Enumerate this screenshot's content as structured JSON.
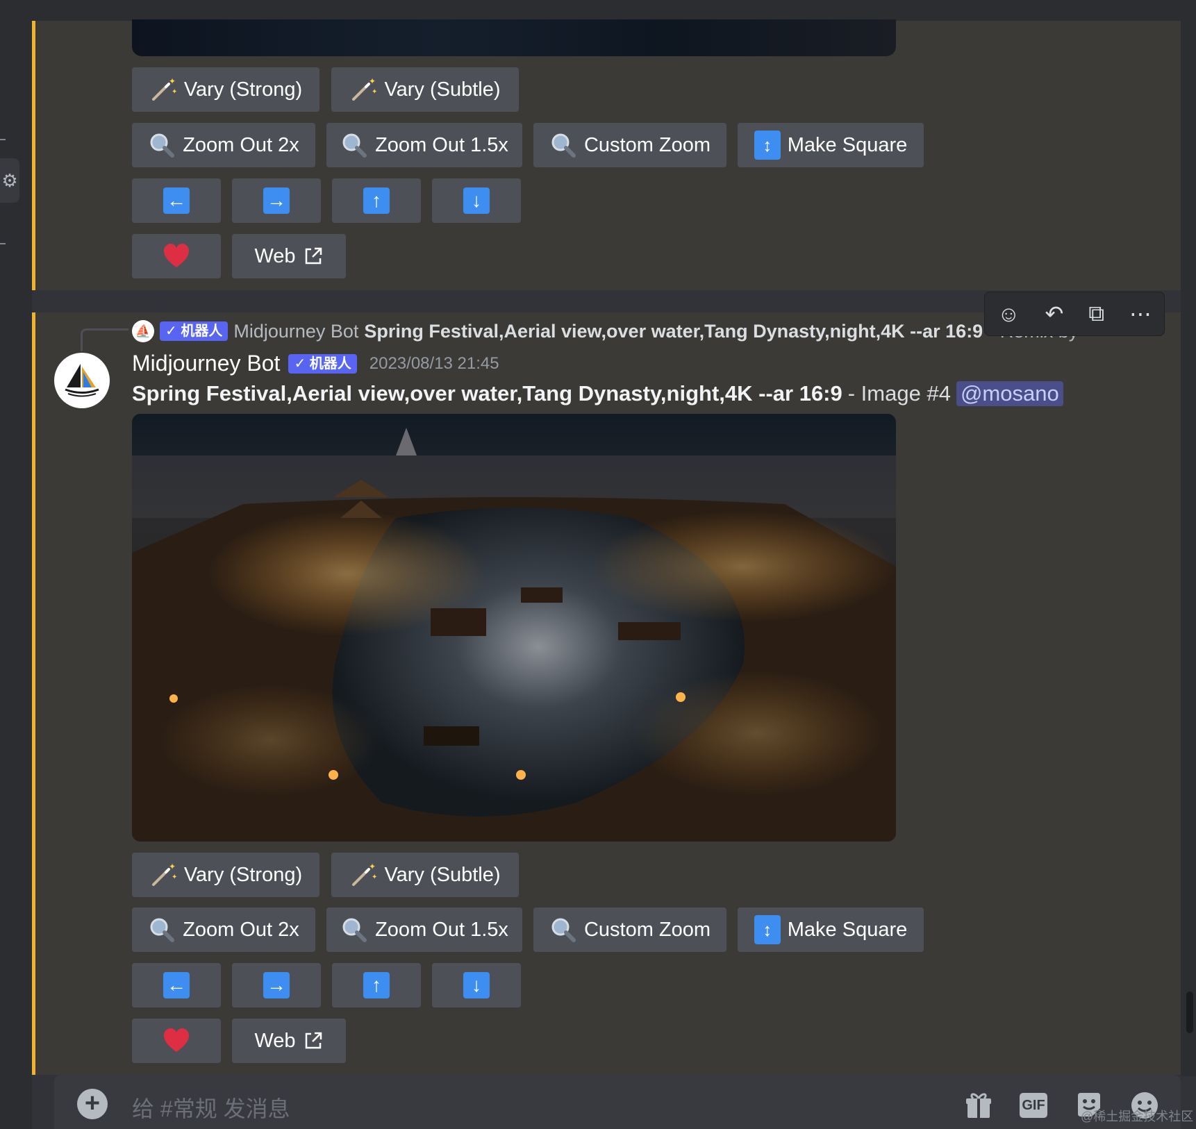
{
  "message_top": {
    "buttons_row1": [
      {
        "label": "Vary (Strong)",
        "icon": "magic-wand-icon"
      },
      {
        "label": "Vary (Subtle)",
        "icon": "magic-wand-icon"
      }
    ],
    "buttons_row2": [
      {
        "label": "Zoom Out 2x",
        "icon": "magnifier-icon"
      },
      {
        "label": "Zoom Out 1.5x",
        "icon": "magnifier-icon"
      },
      {
        "label": "Custom Zoom",
        "icon": "magnifier-icon"
      },
      {
        "label": "Make Square",
        "icon": "up-down-arrow-icon"
      }
    ],
    "pan_buttons": [
      "arrow-left-icon",
      "arrow-right-icon",
      "arrow-up-icon",
      "arrow-down-icon"
    ],
    "favorite_icon": "heart-icon",
    "web_label": "Web"
  },
  "reply": {
    "badge": "✓ 机器人",
    "name": "Midjourney Bot",
    "text": "Spring Festival,Aerial view,over water,Tang Dynasty,night,4K --ar 16:9",
    "trailing": "- Remix by"
  },
  "hover_toolbar": [
    "add-reaction-icon",
    "reply-icon",
    "create-thread-icon",
    "more-icon"
  ],
  "message": {
    "author": "Midjourney Bot",
    "badge": "✓ 机器人",
    "timestamp": "2023/08/13 21:45",
    "prompt": "Spring Festival,Aerial view,over water,Tang Dynasty,night,4K --ar 16:9",
    "suffix": "- Image #4",
    "mention": "@mosano",
    "buttons_row1": [
      {
        "label": "Vary (Strong)",
        "icon": "magic-wand-icon"
      },
      {
        "label": "Vary (Subtle)",
        "icon": "magic-wand-icon"
      }
    ],
    "buttons_row2": [
      {
        "label": "Zoom Out 2x",
        "icon": "magnifier-icon"
      },
      {
        "label": "Zoom Out 1.5x",
        "icon": "magnifier-icon"
      },
      {
        "label": "Custom Zoom",
        "icon": "magnifier-icon"
      },
      {
        "label": "Make Square",
        "icon": "up-down-arrow-icon"
      }
    ],
    "pan_buttons": [
      "arrow-left-icon",
      "arrow-right-icon",
      "arrow-up-icon",
      "arrow-down-icon"
    ],
    "favorite_icon": "heart-icon",
    "web_label": "Web"
  },
  "composer": {
    "placeholder": "给 #常规 发消息",
    "gif_label": "GIF",
    "icons": [
      "add-icon",
      "gift-icon",
      "gif-icon",
      "sticker-icon",
      "emoji-icon"
    ]
  },
  "watermark": "@稀土掘金技术社区",
  "colors": {
    "background": "#313338",
    "message_highlight": "#3c3a36",
    "accent_bar": "#f0b232",
    "button": "#4e5058",
    "blue_icon": "#3d8ef0",
    "bot_badge": "#5865f2"
  }
}
